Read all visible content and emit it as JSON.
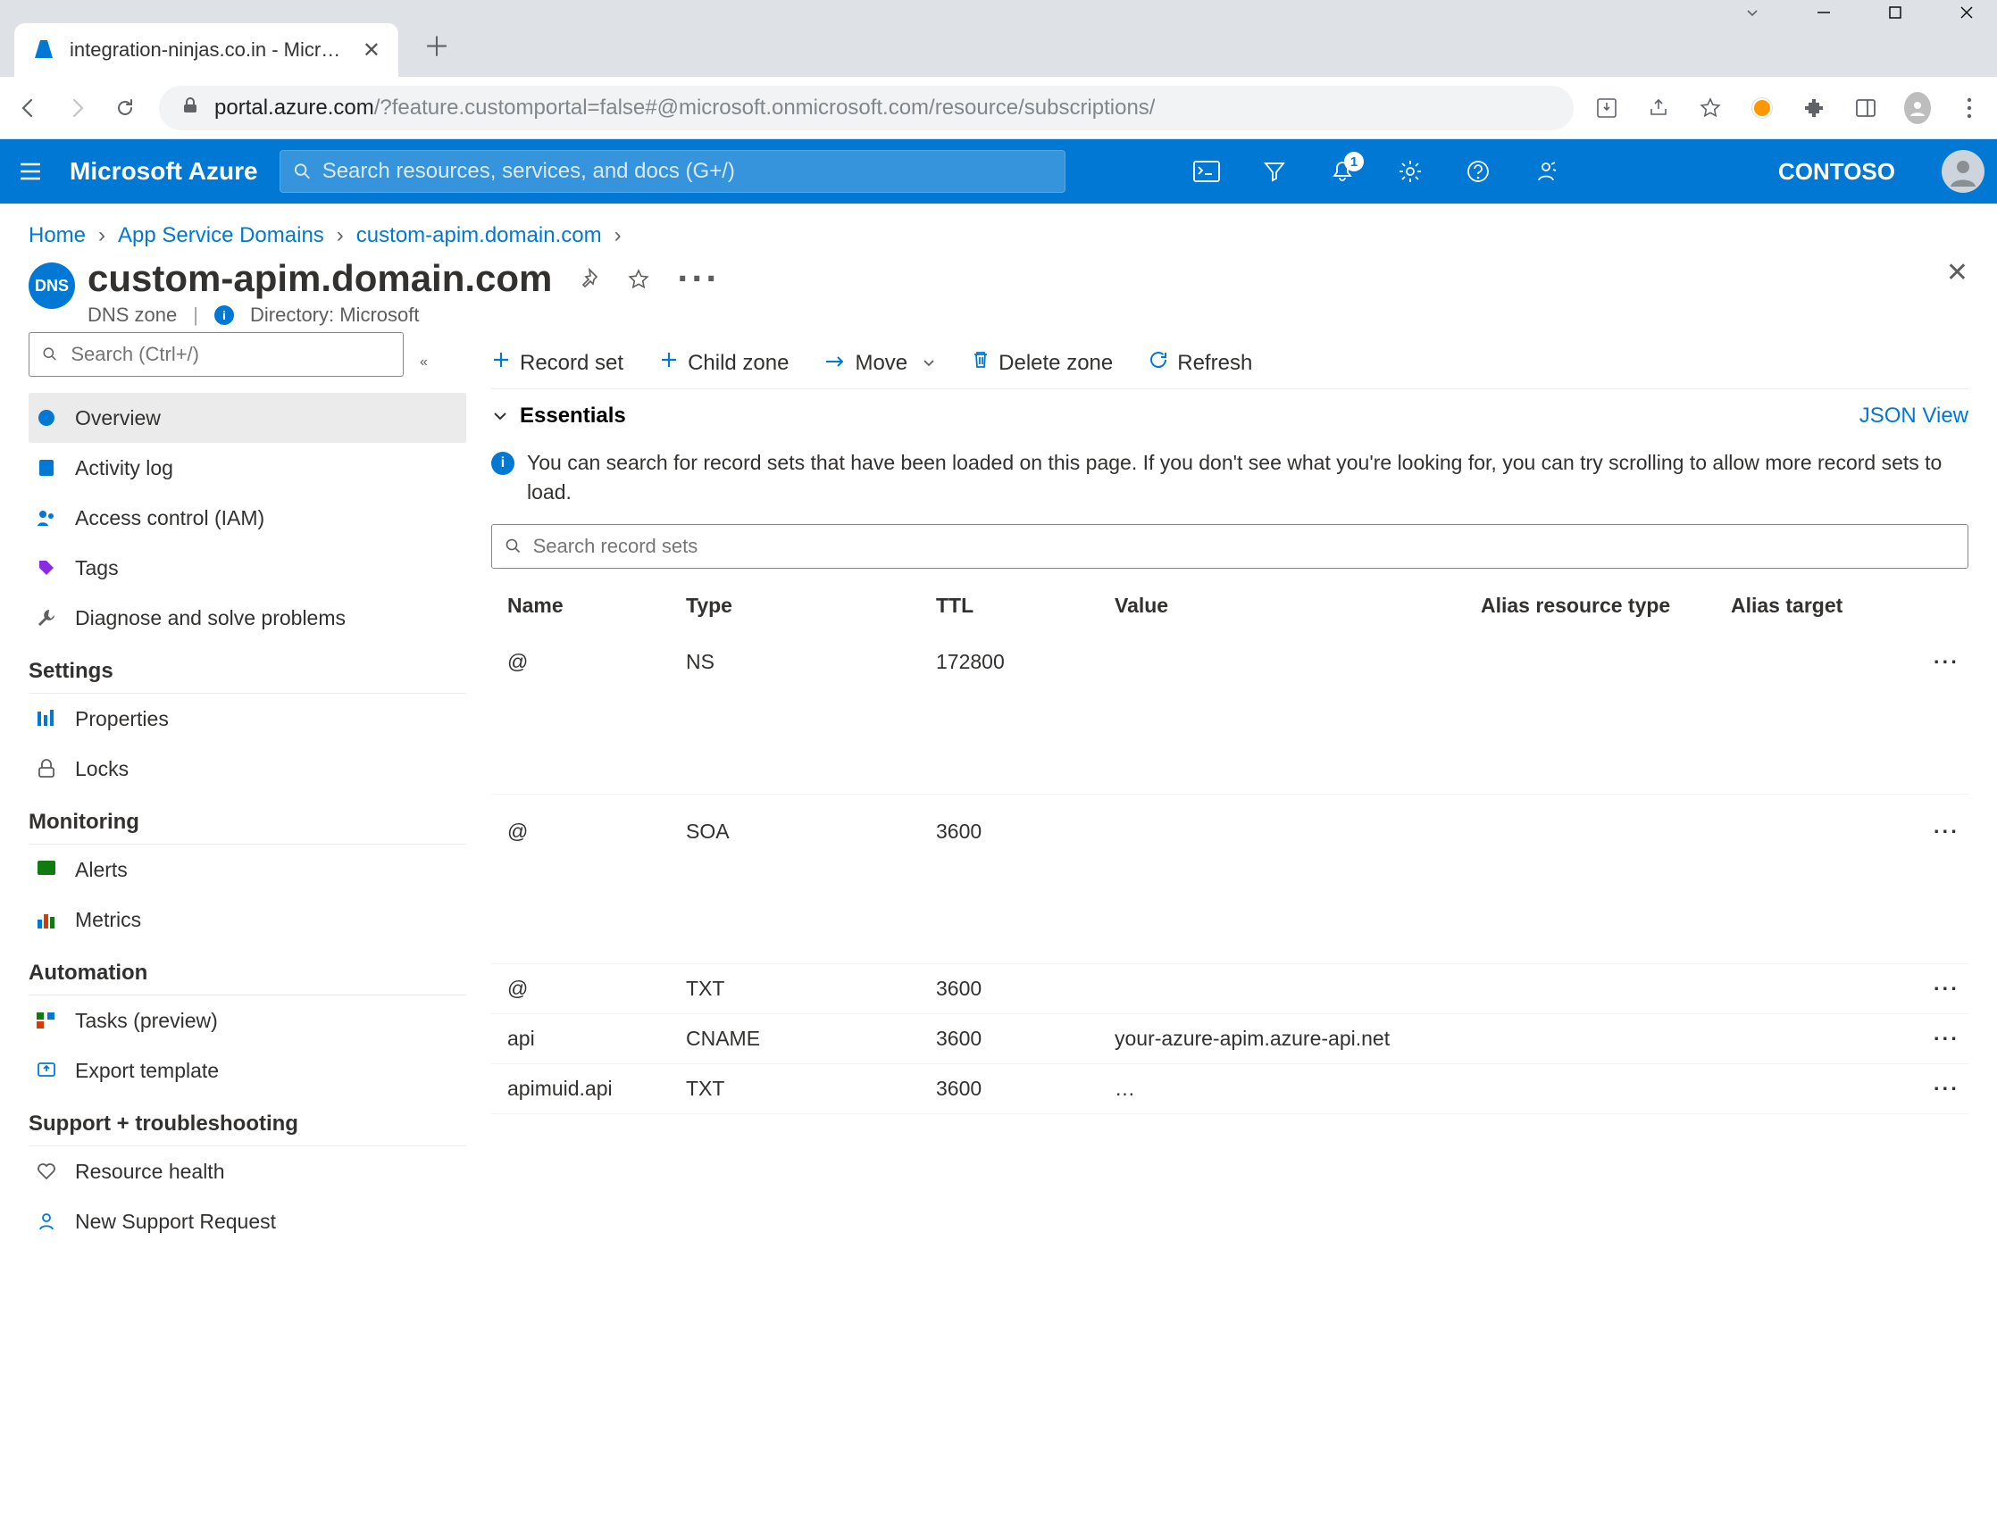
{
  "browser": {
    "tab_title": "integration-ninjas.co.in - Microso",
    "url_host": "portal.azure.com",
    "url_path": "/?feature.customportal=false#@microsoft.onmicrosoft.com/resource/subscriptions/"
  },
  "header": {
    "brand": "Microsoft Azure",
    "search_placeholder": "Search resources, services, and docs (G+/)",
    "notification_count": "1",
    "tenant": "CONTOSO"
  },
  "crumbs": {
    "home": "Home",
    "service": "App Service Domains",
    "resource": "custom-apim.domain.com"
  },
  "page": {
    "title": "custom-apim.domain.com",
    "subtitle": "DNS zone",
    "directory_label": "Directory: Microsoft"
  },
  "sidebar": {
    "search_placeholder": "Search (Ctrl+/)",
    "items": [
      "Overview",
      "Activity log",
      "Access control (IAM)",
      "Tags",
      "Diagnose and solve problems"
    ],
    "settings_heading": "Settings",
    "settings_items": [
      "Properties",
      "Locks"
    ],
    "monitoring_heading": "Monitoring",
    "monitoring_items": [
      "Alerts",
      "Metrics"
    ],
    "automation_heading": "Automation",
    "automation_items": [
      "Tasks (preview)",
      "Export template"
    ],
    "support_heading": "Support + troubleshooting",
    "support_items": [
      "Resource health",
      "New Support Request"
    ]
  },
  "toolbar": {
    "record_set": "Record set",
    "child_zone": "Child zone",
    "move": "Move",
    "delete_zone": "Delete zone",
    "refresh": "Refresh"
  },
  "essentials": {
    "label": "Essentials",
    "json_view": "JSON View"
  },
  "info_message": "You can search for record sets that have been loaded on this page. If you don't see what you're looking for, you can try scrolling to allow more record sets to load.",
  "record_search_placeholder": "Search record sets",
  "columns": {
    "name": "Name",
    "type": "Type",
    "ttl": "TTL",
    "value": "Value",
    "alias_type": "Alias resource type",
    "alias_target": "Alias target"
  },
  "rows": [
    {
      "name": "@",
      "type": "NS",
      "ttl": "172800",
      "value": "",
      "tall": true
    },
    {
      "name": "@",
      "type": "SOA",
      "ttl": "3600",
      "value": "",
      "tall": true
    },
    {
      "name": "@",
      "type": "TXT",
      "ttl": "3600",
      "value": "",
      "tall": false
    },
    {
      "name": "api",
      "type": "CNAME",
      "ttl": "3600",
      "value": "your-azure-apim.azure-api.net",
      "tall": false
    },
    {
      "name": "apimuid.api",
      "type": "TXT",
      "ttl": "3600",
      "value": "…",
      "tall": false
    }
  ]
}
